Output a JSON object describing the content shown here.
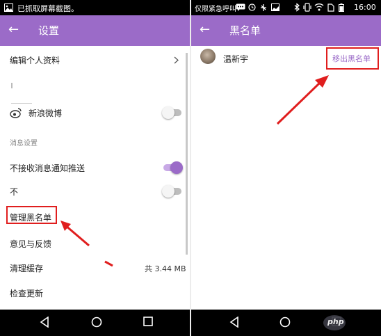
{
  "left": {
    "statusbar": {
      "notification": "已抓取屏幕截图。"
    },
    "appbar": {
      "title": "设置"
    },
    "items": {
      "edit_profile": "编辑个人资料",
      "weibo": "新浪微博",
      "section_message": "消息设置",
      "no_push": "不接收消息通知推送",
      "no": "不",
      "manage_blacklist": "管理黑名单",
      "feedback": "意见与反馈",
      "clear_cache": "清理缓存",
      "cache_size": "共 3.44 MB",
      "check_update": "检查更新"
    },
    "toggles": {
      "weibo": false,
      "no_push": true,
      "no": false
    }
  },
  "right": {
    "statusbar": {
      "carrier": "仅限紧急呼叫",
      "time": "16:00"
    },
    "appbar": {
      "title": "黑名单"
    },
    "entry": {
      "name": "温新宇",
      "action": "移出黑名单"
    }
  },
  "colors": {
    "accent": "#9b6bc8",
    "annotation": "#e01e1e"
  },
  "watermark": "php"
}
